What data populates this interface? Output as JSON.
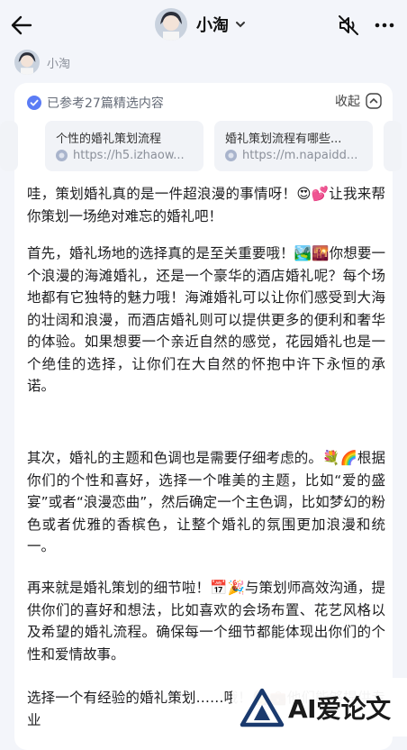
{
  "header": {
    "title": "小淘",
    "back_icon": "arrow-left-icon",
    "dropdown_icon": "chevron-down-icon",
    "mute_icon": "speaker-muted-icon",
    "more_icon": "more-dots-icon"
  },
  "message": {
    "sender": "小淘",
    "references": {
      "text": "已参考27篇精选内容",
      "collapse_label": "收起",
      "sources": [
        {
          "title": "个性的婚礼策划流程",
          "url": "https://h5.izhaow..."
        },
        {
          "title": "婚礼策划流程有哪些...",
          "url": "https://m.napaidd..."
        }
      ]
    },
    "paragraphs": [
      "哇，策划婚礼真的是一件超浪漫的事情呀！😍💕让我来帮你策划一场绝对难忘的婚礼吧！",
      "首先，婚礼场地的选择真的是至关重要哦！🏞️🌇你想要一个浪漫的海滩婚礼，还是一个豪华的酒店婚礼呢？每个场地都有它独特的魅力哦！海滩婚礼可以让你们感受到大海的壮阔和浪漫，而酒店婚礼则可以提供更多的便利和奢华的体验。如果想要一个亲近自然的感觉，花园婚礼也是一个绝佳的选择，让你们在大自然的怀抱中许下永恒的承诺。",
      "其次，婚礼的主题和色调也是需要仔细考虑的。💐🌈根据你们的个性和喜好，选择一个唯美的主题，比如“爱的盛宴”或者“浪漫恋曲”，然后确定一个主色调，比如梦幻的粉色或者优雅的香槟色，让整个婚礼的氛围更加浪漫和统一。",
      "再来就是婚礼策划的细节啦！📅🎉与策划师高效沟通，提供你们的喜好和想法，比如喜欢的会场布置、花艺风格以及希望的婚礼流程。确保每一个细节都能体现出你们的个性和爱情故事。",
      "选择一个有经验的婚礼策划……哦！👩💼他们能够提供专业"
    ]
  },
  "watermark": {
    "text": "AI爱论文"
  },
  "colors": {
    "accent": "#5b7cf5",
    "background": "#f3f5fa",
    "card": "#ffffff"
  }
}
